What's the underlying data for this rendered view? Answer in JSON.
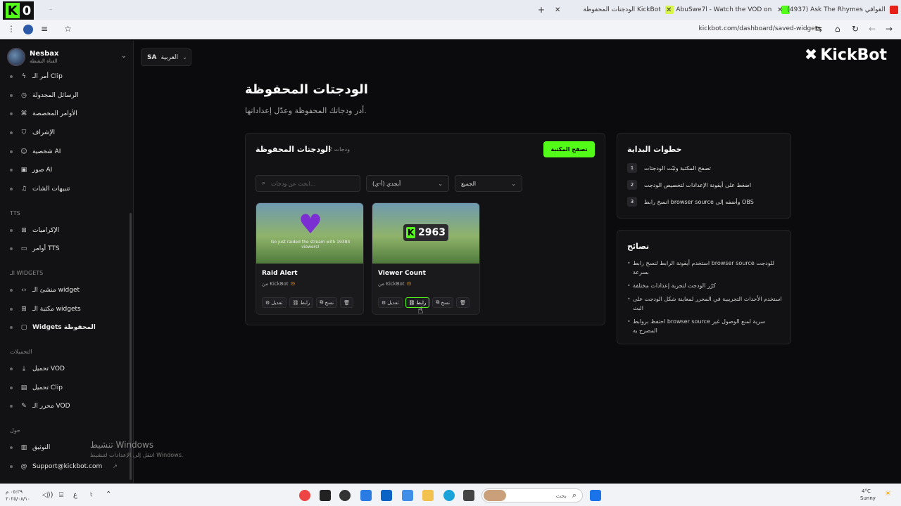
{
  "browser": {
    "counter_badge": "0",
    "tabs": [
      {
        "title": "الودجتات المحفوظة KickBot"
      },
      {
        "title": "AbuSwe7l - Watch the VOD on"
      },
      {
        "title": "(4937) Ask The Rhymes القوافي"
      }
    ],
    "url": "kickbot.com/dashboard/saved-widgets"
  },
  "user": {
    "name": "Nesbax",
    "channel": "القناة النشطة"
  },
  "language": {
    "code": "SA",
    "label": "العربية"
  },
  "brand": {
    "name": "KickBot"
  },
  "sidebar": {
    "items_top": [
      {
        "label": "أمر الـ Clip",
        "icon": "bolt-icon"
      },
      {
        "label": "الرسائل المجدولة",
        "icon": "clock-icon"
      },
      {
        "label": "الأوامر المخصصة",
        "icon": "command-icon"
      },
      {
        "label": "الإشراف",
        "icon": "shield-icon"
      },
      {
        "label": "شخصية AI",
        "icon": "robot-icon"
      },
      {
        "label": "صور AI",
        "icon": "image-icon"
      },
      {
        "label": "تنبيهات الشات",
        "icon": "bell-icon"
      }
    ],
    "section_tts": "TTS",
    "items_tts": [
      {
        "label": "الإكراميات",
        "icon": "gift-icon"
      },
      {
        "label": "أوامر TTS",
        "icon": "speaker-icon"
      }
    ],
    "section_widgets": "الـ WIDGETS",
    "items_widgets": [
      {
        "label": "منشئ الـ widget",
        "icon": "code-icon"
      },
      {
        "label": "مكتبة الـ widgets",
        "icon": "grid-icon"
      },
      {
        "label": "Widgets المحفوظة",
        "icon": "bookmark-icon"
      }
    ],
    "section_downloads": "التحميلات",
    "items_downloads": [
      {
        "label": "تحميل VOD",
        "icon": "download-icon"
      },
      {
        "label": "تحميل Clip",
        "icon": "file-icon"
      },
      {
        "label": "محرر الـ VOD",
        "icon": "pen-icon"
      }
    ],
    "section_about": "حول",
    "items_about": [
      {
        "label": "التوثيق",
        "icon": "book-icon"
      },
      {
        "label": "Support@kickbot.com",
        "icon": "at-icon"
      }
    ]
  },
  "page": {
    "title": "الودجتات المحفوظة",
    "subtitle": "أدر ودجاتك المحفوظة وعدّل إعداداتها."
  },
  "saved": {
    "title": "الودجتات المحفوظة",
    "count": "2 ودجات",
    "browse_button": "تصفح المكتبة",
    "search_placeholder": "ابحث عن ودجات...",
    "sort_value": "أبجدي (أ-ي)",
    "filter_value": "الجميع",
    "widgets": [
      {
        "name": "Raid Alert",
        "by": "من KickBot",
        "preview_text": "Go just raided the stream with 19384 viewers!",
        "actions": {
          "edit": "تعديل",
          "link": "رابط",
          "copy": "نسخ"
        }
      },
      {
        "name": "Viewer Count",
        "by": "من KickBot",
        "preview_value": "2963",
        "actions": {
          "edit": "تعديل",
          "link": "رابط",
          "copy": "نسخ"
        }
      }
    ]
  },
  "getting_started": {
    "title": "خطوات البداية",
    "steps": [
      {
        "num": "1",
        "text": "تصفح المكتبة وثبّت الودجتات"
      },
      {
        "num": "2",
        "text": "اضغط على أيقونة الإعدادات لتخصيص الودجت"
      },
      {
        "num": "3",
        "text": "انسخ رابط browser source وأضفه إلى OBS"
      }
    ]
  },
  "tips": {
    "title": "نصائح",
    "items": [
      "استخدم أيقونة الرابط لنسخ رابط browser source للودجت بسرعة",
      "كرّر الودجت لتجربة إعدادات مختلفة",
      "استخدم الأحداث التجريبية في المحرر لمعاينة شكل الودجت على البث",
      "احتفظ بروابط browser source سرية لمنع الوصول غير المصرح به"
    ]
  },
  "watermark": {
    "line1": "تنشيط Windows",
    "line2": "انتقل إلى الإعدادات لتنشيط Windows."
  },
  "taskbar": {
    "search_label": "بحث",
    "weather_temp": "4°C",
    "weather_desc": "Sunny",
    "time": "٠٥:٢٩ م",
    "date": "٢٠٢٥/٠٨/١٠"
  },
  "colors": {
    "accent": "#53fc18",
    "background": "#0b0b0d",
    "panel": "#121214"
  }
}
